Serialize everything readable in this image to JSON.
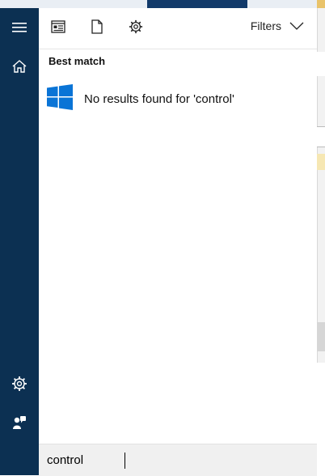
{
  "background_colors": {
    "rail": "#0c3052",
    "panel": "#ffffff",
    "search_bar": "#f0f0f0",
    "windows_logo": "#0a74d6"
  },
  "icons": {
    "hamburger": "menu-icon",
    "home": "home-icon",
    "settings": "gear-icon",
    "user": "user-feedback-icon",
    "apps": "apps-icon",
    "documents": "document-icon",
    "web_settings": "gear-icon",
    "filters": "chevron-down-icon",
    "result": "windows-logo-icon"
  },
  "toolbar": {
    "filters_label": "Filters"
  },
  "results": {
    "section_title": "Best match",
    "items": [
      {
        "label": "No results found for 'control'"
      }
    ]
  },
  "search": {
    "value": "control"
  }
}
